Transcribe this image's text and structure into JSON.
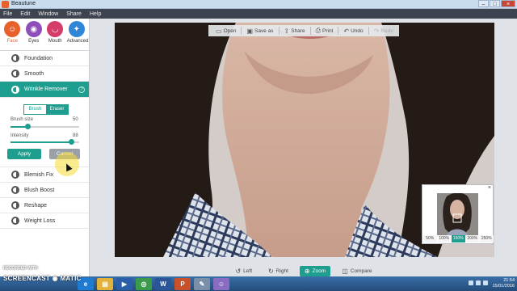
{
  "window": {
    "title": "Beautune",
    "controls": [
      "–",
      "□",
      "×"
    ]
  },
  "menubar": [
    "File",
    "Edit",
    "Window",
    "Share",
    "Help"
  ],
  "categories": [
    {
      "label": "Face",
      "icon": "face-icon",
      "glyph": "☺",
      "color": "#e8602c",
      "active": true
    },
    {
      "label": "Eyes",
      "icon": "eye-icon",
      "glyph": "◉",
      "color": "#8e4fb8",
      "active": false
    },
    {
      "label": "Mouth",
      "icon": "mouth-icon",
      "glyph": "◡",
      "color": "#d63c6a",
      "active": false
    },
    {
      "label": "Advanced",
      "icon": "advanced-icon",
      "glyph": "✦",
      "color": "#2f86d6",
      "active": false
    }
  ],
  "tools": {
    "foundation": "Foundation",
    "smooth": "Smooth",
    "wrinkle_remover": "Wrinkle Remover",
    "help": "?",
    "blemish_fix": "Blemish Fix",
    "blush_boost": "Blush Boost",
    "reshape": "Reshape",
    "weight_loss": "Weight Loss"
  },
  "wrinkle_panel": {
    "brush_label": "Brush",
    "eraser_label": "Eraser",
    "brush_size_label": "Brush size",
    "brush_size_value": "50",
    "brush_size_fraction": 0.25,
    "intensity_label": "Intensity",
    "intensity_value": "88",
    "intensity_fraction": 0.88,
    "apply_label": "Apply",
    "cancel_label": "Cancel"
  },
  "toolbar": {
    "open": "Open",
    "save_as": "Save as",
    "share": "Share",
    "print": "Print",
    "undo": "Undo",
    "redo": "Redo"
  },
  "bottombar": {
    "left": "Left",
    "right": "Right",
    "zoom": "Zoom",
    "compare": "Compare"
  },
  "preview": {
    "close": "×",
    "zoom_levels": [
      "50%",
      "100%",
      "150%",
      "200%",
      "250%"
    ],
    "selected_zoom": "150%"
  },
  "watermark": {
    "line1": "RECORDED WITH",
    "line2": "SCREENCAST ◉ MATIC"
  },
  "taskbar": {
    "apps": [
      {
        "name": "ie-icon",
        "glyph": "e",
        "color": "#1d7bd2"
      },
      {
        "name": "explorer-icon",
        "glyph": "▤",
        "color": "#e2b23a"
      },
      {
        "name": "media-player-icon",
        "glyph": "▶",
        "color": "#2b5ea8"
      },
      {
        "name": "chrome-icon",
        "glyph": "◎",
        "color": "#3a9b4a"
      },
      {
        "name": "word-icon",
        "glyph": "W",
        "color": "#2a5699"
      },
      {
        "name": "powerpoint-icon",
        "glyph": "P",
        "color": "#c8502b"
      },
      {
        "name": "paint-icon",
        "glyph": "✎",
        "color": "#7a8fa8"
      },
      {
        "name": "beautune-icon",
        "glyph": "☺",
        "color": "#8a6cc0"
      }
    ],
    "time": "21:54",
    "date": "15/01/2016"
  }
}
